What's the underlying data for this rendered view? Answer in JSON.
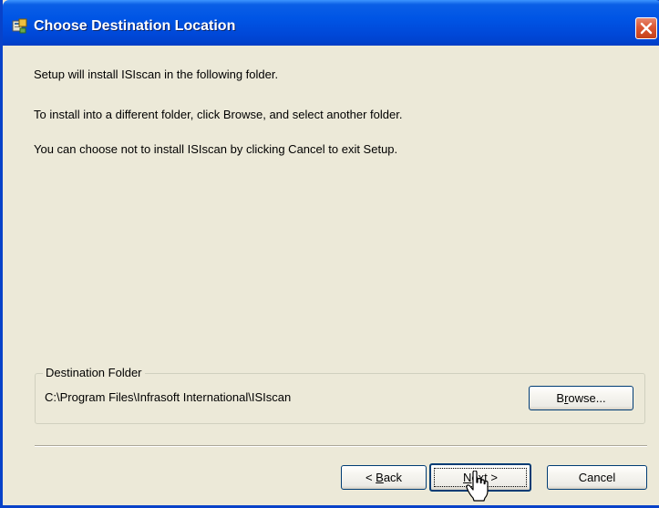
{
  "window": {
    "title": "Choose Destination Location",
    "accent_color": "#0055E5",
    "close_icon": "close-icon"
  },
  "content": {
    "line1": "Setup will install ISIscan in the following folder.",
    "line2": "To install into a different folder, click Browse, and select another folder.",
    "line3": "You can choose not to install ISIscan by clicking Cancel to exit Setup."
  },
  "destination": {
    "group_label": "Destination Folder",
    "path": "C:\\Program Files\\Infrasoft International\\ISIscan",
    "browse_label_pre": "B",
    "browse_label_u": "r",
    "browse_label_post": "owse..."
  },
  "buttons": {
    "back_pre": "< ",
    "back_u": "B",
    "back_post": "ack",
    "next_u": "N",
    "next_post": "ext >",
    "cancel": "Cancel"
  }
}
